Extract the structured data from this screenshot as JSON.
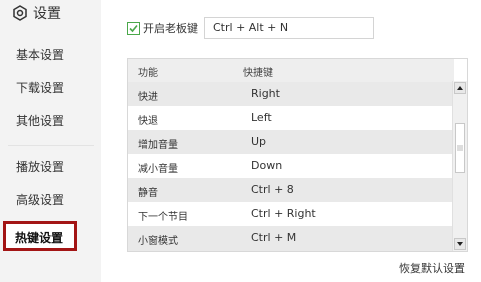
{
  "sidebar": {
    "title": "设置",
    "items": [
      {
        "label": "基本设置"
      },
      {
        "label": "下载设置"
      },
      {
        "label": "其他设置"
      },
      {
        "label": "播放设置"
      },
      {
        "label": "高级设置"
      },
      {
        "label": "热键设置"
      }
    ],
    "active_index": 5
  },
  "hotkey": {
    "checkbox_label": "开启老板键",
    "checked": true,
    "value": "Ctrl + Alt + N"
  },
  "table": {
    "headers": [
      "功能",
      "快捷键"
    ],
    "rows": [
      {
        "func": "快进",
        "key": "Right"
      },
      {
        "func": "快退",
        "key": "Left"
      },
      {
        "func": "增加音量",
        "key": "Up"
      },
      {
        "func": "减小音量",
        "key": "Down"
      },
      {
        "func": "静音",
        "key": "Ctrl + 8"
      },
      {
        "func": "下一个节目",
        "key": "Ctrl + Right"
      },
      {
        "func": "小窗模式",
        "key": "Ctrl + M"
      }
    ]
  },
  "footer": {
    "restore_label": "恢复默认设置"
  },
  "colors": {
    "active_border": "#a31515",
    "checkbox_green": "#4aa84a"
  }
}
